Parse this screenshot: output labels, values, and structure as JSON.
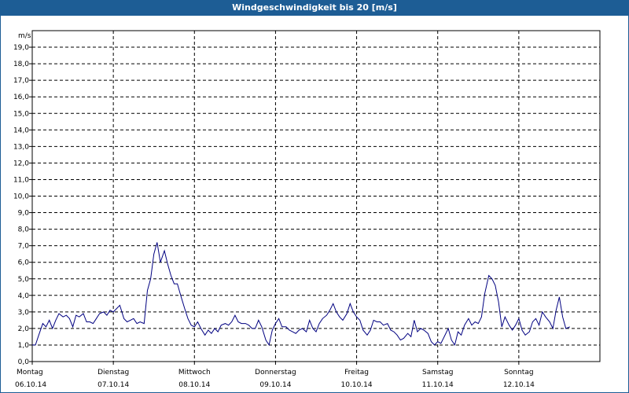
{
  "window": {
    "title": "Windgeschwindigkeit bis 20 [m/s]"
  },
  "chart_data": {
    "type": "line",
    "title": "Windgeschwindigkeit bis 20 [m/s]",
    "ylabel": "m/s",
    "xlabel": "",
    "ylim": [
      0,
      20
    ],
    "xlim": [
      0,
      7
    ],
    "grid": true,
    "y_ticks": [
      "0,0",
      "1,0",
      "2,0",
      "3,0",
      "4,0",
      "5,0",
      "6,0",
      "7,0",
      "8,0",
      "9,0",
      "10,0",
      "11,0",
      "12,0",
      "13,0",
      "14,0",
      "15,0",
      "16,0",
      "17,0",
      "18,0",
      "19,0"
    ],
    "x_days": [
      {
        "day": "Montag",
        "date": "06.10.14"
      },
      {
        "day": "Dienstag",
        "date": "07.10.14"
      },
      {
        "day": "Mittwoch",
        "date": "08.10.14"
      },
      {
        "day": "Donnerstag",
        "date": "09.10.14"
      },
      {
        "day": "Freitag",
        "date": "10.10.14"
      },
      {
        "day": "Samstag",
        "date": "11.10.14"
      },
      {
        "day": "Sonntag",
        "date": "12.10.14"
      }
    ],
    "series": [
      {
        "color": "#000080",
        "points": [
          [
            0.0,
            1.0
          ],
          [
            0.04,
            1.0
          ],
          [
            0.08,
            1.6
          ],
          [
            0.13,
            2.3
          ],
          [
            0.17,
            2.1
          ],
          [
            0.21,
            2.5
          ],
          [
            0.25,
            2.0
          ],
          [
            0.29,
            2.5
          ],
          [
            0.33,
            2.9
          ],
          [
            0.38,
            2.7
          ],
          [
            0.42,
            2.8
          ],
          [
            0.46,
            2.6
          ],
          [
            0.5,
            2.1
          ],
          [
            0.54,
            2.8
          ],
          [
            0.58,
            2.7
          ],
          [
            0.63,
            2.9
          ],
          [
            0.67,
            2.4
          ],
          [
            0.71,
            2.4
          ],
          [
            0.75,
            2.3
          ],
          [
            0.79,
            2.6
          ],
          [
            0.83,
            2.9
          ],
          [
            0.88,
            3.0
          ],
          [
            0.92,
            2.8
          ],
          [
            0.96,
            3.1
          ],
          [
            1.0,
            3.0
          ],
          [
            1.04,
            3.2
          ],
          [
            1.08,
            3.4
          ],
          [
            1.13,
            2.6
          ],
          [
            1.17,
            2.4
          ],
          [
            1.21,
            2.5
          ],
          [
            1.25,
            2.6
          ],
          [
            1.29,
            2.3
          ],
          [
            1.33,
            2.4
          ],
          [
            1.38,
            2.3
          ],
          [
            1.42,
            4.3
          ],
          [
            1.46,
            5.0
          ],
          [
            1.5,
            6.5
          ],
          [
            1.54,
            7.2
          ],
          [
            1.58,
            6.0
          ],
          [
            1.63,
            6.7
          ],
          [
            1.67,
            5.9
          ],
          [
            1.71,
            5.2
          ],
          [
            1.75,
            4.7
          ],
          [
            1.79,
            4.7
          ],
          [
            1.83,
            4.0
          ],
          [
            1.88,
            3.2
          ],
          [
            1.92,
            2.6
          ],
          [
            1.96,
            2.2
          ],
          [
            2.0,
            2.1
          ],
          [
            2.04,
            2.4
          ],
          [
            2.08,
            2.0
          ],
          [
            2.13,
            1.6
          ],
          [
            2.17,
            1.9
          ],
          [
            2.21,
            1.7
          ],
          [
            2.25,
            2.0
          ],
          [
            2.29,
            1.8
          ],
          [
            2.33,
            2.2
          ],
          [
            2.38,
            2.3
          ],
          [
            2.42,
            2.2
          ],
          [
            2.46,
            2.4
          ],
          [
            2.5,
            2.8
          ],
          [
            2.54,
            2.4
          ],
          [
            2.58,
            2.3
          ],
          [
            2.63,
            2.3
          ],
          [
            2.67,
            2.2
          ],
          [
            2.71,
            2.0
          ],
          [
            2.75,
            2.0
          ],
          [
            2.79,
            2.5
          ],
          [
            2.83,
            2.1
          ],
          [
            2.88,
            1.3
          ],
          [
            2.92,
            1.0
          ],
          [
            2.96,
            1.9
          ],
          [
            3.0,
            2.3
          ],
          [
            3.04,
            2.6
          ],
          [
            3.08,
            2.1
          ],
          [
            3.13,
            2.1
          ],
          [
            3.17,
            1.9
          ],
          [
            3.21,
            1.8
          ],
          [
            3.25,
            1.7
          ],
          [
            3.29,
            1.9
          ],
          [
            3.33,
            2.0
          ],
          [
            3.38,
            1.8
          ],
          [
            3.42,
            2.5
          ],
          [
            3.46,
            2.0
          ],
          [
            3.5,
            1.8
          ],
          [
            3.54,
            2.3
          ],
          [
            3.58,
            2.6
          ],
          [
            3.63,
            2.8
          ],
          [
            3.67,
            3.1
          ],
          [
            3.71,
            3.5
          ],
          [
            3.75,
            3.0
          ],
          [
            3.79,
            2.7
          ],
          [
            3.83,
            2.5
          ],
          [
            3.88,
            2.9
          ],
          [
            3.92,
            3.5
          ],
          [
            3.96,
            3.0
          ],
          [
            4.0,
            2.7
          ],
          [
            4.04,
            2.5
          ],
          [
            4.08,
            1.9
          ],
          [
            4.13,
            1.6
          ],
          [
            4.17,
            1.9
          ],
          [
            4.21,
            2.5
          ],
          [
            4.25,
            2.4
          ],
          [
            4.29,
            2.4
          ],
          [
            4.33,
            2.2
          ],
          [
            4.38,
            2.3
          ],
          [
            4.42,
            1.9
          ],
          [
            4.46,
            1.8
          ],
          [
            4.5,
            1.6
          ],
          [
            4.54,
            1.3
          ],
          [
            4.58,
            1.4
          ],
          [
            4.63,
            1.7
          ],
          [
            4.67,
            1.5
          ],
          [
            4.71,
            2.5
          ],
          [
            4.75,
            1.8
          ],
          [
            4.79,
            2.0
          ],
          [
            4.83,
            1.9
          ],
          [
            4.88,
            1.7
          ],
          [
            4.92,
            1.2
          ],
          [
            4.96,
            1.0
          ],
          [
            5.0,
            1.2
          ],
          [
            5.04,
            1.1
          ],
          [
            5.08,
            1.5
          ],
          [
            5.13,
            2.0
          ],
          [
            5.17,
            1.3
          ],
          [
            5.21,
            1.0
          ],
          [
            5.25,
            1.8
          ],
          [
            5.29,
            1.6
          ],
          [
            5.33,
            2.2
          ],
          [
            5.38,
            2.6
          ],
          [
            5.42,
            2.2
          ],
          [
            5.46,
            2.4
          ],
          [
            5.5,
            2.3
          ],
          [
            5.54,
            2.7
          ],
          [
            5.58,
            4.1
          ],
          [
            5.63,
            5.2
          ],
          [
            5.67,
            5.0
          ],
          [
            5.71,
            4.6
          ],
          [
            5.75,
            3.6
          ],
          [
            5.79,
            2.1
          ],
          [
            5.83,
            2.7
          ],
          [
            5.88,
            2.2
          ],
          [
            5.92,
            1.9
          ],
          [
            5.96,
            2.2
          ],
          [
            6.0,
            2.6
          ],
          [
            6.04,
            1.9
          ],
          [
            6.08,
            1.6
          ],
          [
            6.13,
            1.8
          ],
          [
            6.17,
            2.4
          ],
          [
            6.21,
            2.6
          ],
          [
            6.25,
            2.2
          ],
          [
            6.29,
            3.0
          ],
          [
            6.33,
            2.7
          ],
          [
            6.38,
            2.4
          ],
          [
            6.42,
            2.0
          ],
          [
            6.46,
            3.1
          ],
          [
            6.5,
            3.9
          ],
          [
            6.54,
            2.7
          ],
          [
            6.58,
            2.0
          ],
          [
            6.63,
            2.1
          ]
        ]
      }
    ]
  }
}
